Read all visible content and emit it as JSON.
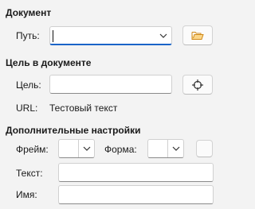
{
  "document": {
    "title": "Документ",
    "path_label": "Путь:",
    "path_value": ""
  },
  "target": {
    "title": "Цель в документе",
    "target_label": "Цель:",
    "target_value": "",
    "url_label": "URL:",
    "url_value": "Тестовый текст"
  },
  "extra": {
    "title": "Дополнительные настройки",
    "frame_label": "Фрейм:",
    "frame_value": "",
    "form_label": "Форма:",
    "form_value": "",
    "text_label": "Текст:",
    "text_value": "",
    "name_label": "Имя:",
    "name_value": ""
  },
  "icons": {
    "open_file": "folder-open-icon",
    "target": "crosshair-icon",
    "dropdown": "chevron-down-icon"
  },
  "colors": {
    "accent": "#1a64c8",
    "folder": "#e8a33a"
  }
}
